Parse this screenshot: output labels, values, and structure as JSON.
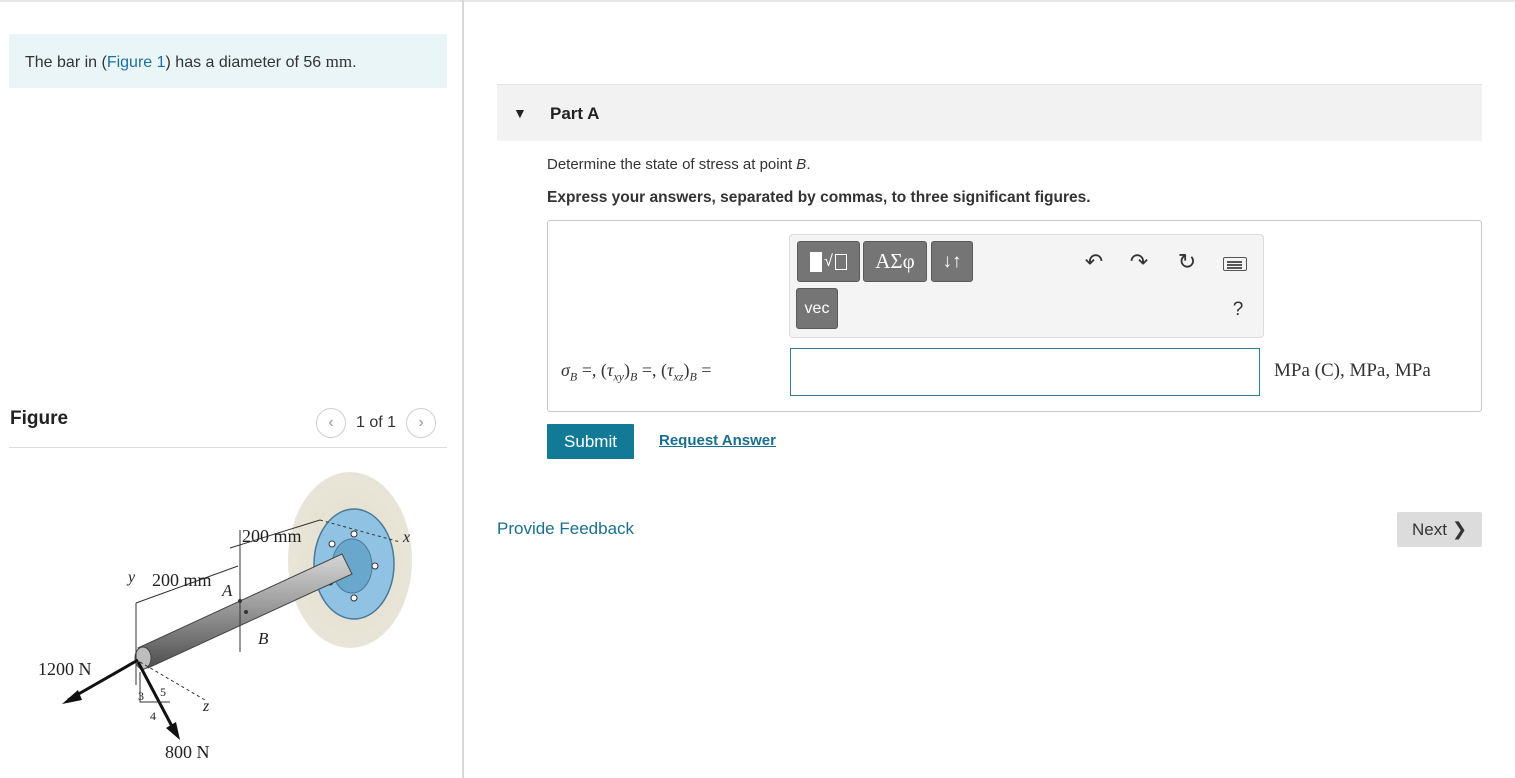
{
  "problem": {
    "text_before": "The bar in (",
    "figure_link": "Figure 1",
    "text_mid": ") has a diameter of 56 ",
    "unit": "mm",
    "text_end": "."
  },
  "figure_panel": {
    "title": "Figure",
    "counter": "1 of 1",
    "prev_icon": "chevron-left-icon",
    "next_icon": "chevron-right-icon"
  },
  "figure": {
    "dim_top": "200 mm",
    "dim_left": "200 mm",
    "axis_y": "y",
    "axis_x": "x",
    "axis_z": "z",
    "point_a": "A",
    "point_b": "B",
    "force_1": "1200 N",
    "force_2": "800 N",
    "slope_3": "3",
    "slope_4": "4",
    "slope_5": "5"
  },
  "part_a": {
    "toggle_icon": "caret-down-icon",
    "title": "Part A",
    "question_prefix": "Determine the state of stress at point ",
    "question_point": "B",
    "question_suffix": ".",
    "instruction": "Express your answers, separated by commas, to three significant figures."
  },
  "toolbar": {
    "templates_icon": "templates-icon",
    "greek_label": "ΑΣφ",
    "arrows_label": "↓↑",
    "vec_label": "vec",
    "undo_icon": "undo-icon",
    "redo_icon": "redo-icon",
    "reset_icon": "reset-icon",
    "keyboard_icon": "keyboard-icon",
    "help_label": "?"
  },
  "answer": {
    "value": "",
    "units": "MPa (C), MPa, MPa"
  },
  "actions": {
    "submit": "Submit",
    "request_answer": "Request Answer",
    "provide_feedback": "Provide Feedback",
    "next": "Next"
  },
  "colors": {
    "accent": "#127a96",
    "link": "#1a6f8f",
    "problem_bg": "#e9f5f7",
    "toolbar_button": "#757575"
  }
}
